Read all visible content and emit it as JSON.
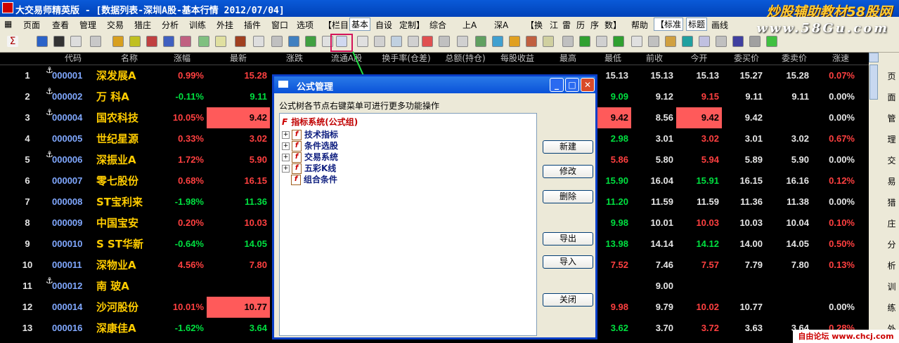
{
  "window": {
    "title": "大交易师精英版 - [数据列表-深圳A股-基本行情 2012/07/04]"
  },
  "watermark": {
    "line1": "炒股辅助教材58股网",
    "line2": "www.58Gu.com",
    "footer": "自由论坛 www.chcj.com"
  },
  "menu": {
    "items": [
      "页面",
      "查看",
      "管理",
      "交易",
      "猎庄",
      "分析",
      "训练",
      "外挂",
      "插件",
      "窗口",
      "选项"
    ],
    "segments": [
      "【栏目",
      "基本",
      "自设",
      "定制】",
      "综合",
      "上A",
      "深A",
      "【换",
      "江",
      "雷",
      "历",
      "序",
      "数】",
      "帮助",
      "【标准",
      "标题",
      "画线"
    ]
  },
  "table": {
    "headers": [
      "代码",
      "名称",
      "涨幅",
      "最新",
      "涨跌",
      "流通A股",
      "换手率(仓差)",
      "总额(持仓)",
      "每股收益",
      "最高",
      "最低",
      "前收",
      "今开",
      "委买价",
      "委卖价",
      "涨速"
    ],
    "rows": [
      {
        "idx": "1",
        "anchor": true,
        "code": "000001",
        "name": "深发展A",
        "chg": "0.99%",
        "last": "15.28",
        "low": "15.13",
        "prev": "15.13",
        "open": "15.13",
        "bid": "15.27",
        "ask": "15.28",
        "speed": "0.07%"
      },
      {
        "idx": "2",
        "anchor": true,
        "code": "000002",
        "name": "万 科A",
        "chg": "-0.11%",
        "last": "9.11",
        "low": "9.09",
        "prev": "9.12",
        "open": "9.15",
        "bid": "9.11",
        "ask": "9.11",
        "speed": "0.00%"
      },
      {
        "idx": "3",
        "anchor": true,
        "code": "000004",
        "name": "国农科技",
        "chg": "10.05%",
        "last": "9.42",
        "low": "9.42",
        "prev": "8.56",
        "open": "9.42",
        "bid": "9.42",
        "ask": "",
        "speed": "0.00%"
      },
      {
        "idx": "4",
        "anchor": false,
        "code": "000005",
        "name": "世纪星源",
        "chg": "0.33%",
        "last": "3.02",
        "low": "2.98",
        "prev": "3.01",
        "open": "3.02",
        "bid": "3.01",
        "ask": "3.02",
        "speed": "0.67%"
      },
      {
        "idx": "5",
        "anchor": true,
        "code": "000006",
        "name": "深振业A",
        "chg": "1.72%",
        "last": "5.90",
        "low": "5.86",
        "prev": "5.80",
        "open": "5.94",
        "bid": "5.89",
        "ask": "5.90",
        "speed": "0.00%"
      },
      {
        "idx": "6",
        "anchor": false,
        "code": "000007",
        "name": "零七股份",
        "chg": "0.68%",
        "last": "16.15",
        "low": "15.90",
        "prev": "16.04",
        "open": "15.91",
        "bid": "16.15",
        "ask": "16.16",
        "speed": "0.12%"
      },
      {
        "idx": "7",
        "anchor": false,
        "code": "000008",
        "name": "ST宝利来",
        "chg": "-1.98%",
        "last": "11.36",
        "low": "11.20",
        "prev": "11.59",
        "open": "11.59",
        "bid": "11.36",
        "ask": "11.38",
        "speed": "0.00%"
      },
      {
        "idx": "8",
        "anchor": false,
        "code": "000009",
        "name": "中国宝安",
        "chg": "0.20%",
        "last": "10.03",
        "low": "9.98",
        "prev": "10.01",
        "open": "10.03",
        "bid": "10.03",
        "ask": "10.04",
        "speed": "0.10%"
      },
      {
        "idx": "9",
        "anchor": false,
        "code": "000010",
        "name": "S ST华新",
        "chg": "-0.64%",
        "last": "14.05",
        "low": "13.98",
        "prev": "14.14",
        "open": "14.12",
        "bid": "14.00",
        "ask": "14.05",
        "speed": "0.50%"
      },
      {
        "idx": "10",
        "anchor": false,
        "code": "000011",
        "name": "深物业A",
        "chg": "4.56%",
        "last": "7.80",
        "low": "7.52",
        "prev": "7.46",
        "open": "7.57",
        "bid": "7.79",
        "ask": "7.80",
        "speed": "0.13%"
      },
      {
        "idx": "11",
        "anchor": true,
        "code": "000012",
        "name": "南 玻A",
        "chg": "",
        "last": "",
        "low": "",
        "prev": "9.00",
        "open": "",
        "bid": "",
        "ask": "",
        "speed": ""
      },
      {
        "idx": "12",
        "anchor": false,
        "code": "000014",
        "name": "沙河股份",
        "chg": "10.01%",
        "last": "10.77",
        "low": "9.98",
        "prev": "9.79",
        "open": "10.02",
        "bid": "10.77",
        "ask": "",
        "speed": "0.00%"
      },
      {
        "idx": "13",
        "anchor": false,
        "code": "000016",
        "name": "深康佳A",
        "chg": "-1.62%",
        "last": "3.64",
        "low": "3.62",
        "prev": "3.70",
        "open": "3.72",
        "bid": "3.63",
        "ask": "3.64",
        "speed": "0.28%"
      }
    ]
  },
  "side_labels": [
    "页",
    "面",
    "管",
    "理",
    "交",
    "易",
    "猎",
    "庄",
    "分",
    "析",
    "训",
    "练",
    "外"
  ],
  "dialog": {
    "title": "公式管理",
    "hint": "公式树各节点右键菜单可进行更多功能操作",
    "root": "指标系统(公式组)",
    "nodes": [
      "技术指标",
      "条件选股",
      "交易系统",
      "五彩K线",
      "组合条件"
    ],
    "buttons": {
      "new": "新建",
      "edit": "修改",
      "delete": "删除",
      "export": "导出",
      "import": "导入",
      "close": "关闭"
    }
  }
}
